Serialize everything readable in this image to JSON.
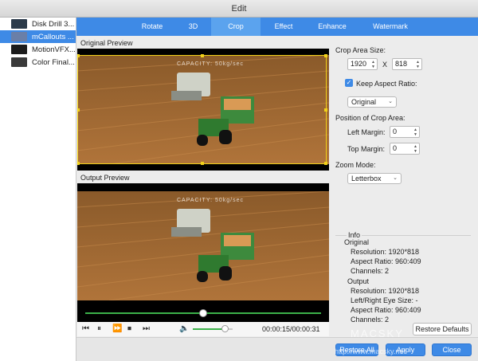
{
  "window": {
    "title": "Edit"
  },
  "files": [
    {
      "name": "Disk Drill 3...",
      "selected": false,
      "thumb_color": "#2b3a4a"
    },
    {
      "name": "mCallouts ...",
      "selected": true,
      "thumb_color": "#6a7fa8"
    },
    {
      "name": "MotionVFX...",
      "selected": false,
      "thumb_color": "#1c1c1c"
    },
    {
      "name": "Color Final...",
      "selected": false,
      "thumb_color": "#3a3a3a"
    }
  ],
  "tabs": [
    {
      "label": "Rotate",
      "active": false
    },
    {
      "label": "3D",
      "active": false
    },
    {
      "label": "Crop",
      "active": true
    },
    {
      "label": "Effect",
      "active": false
    },
    {
      "label": "Enhance",
      "active": false
    },
    {
      "label": "Watermark",
      "active": false
    }
  ],
  "preview": {
    "original_label": "Original Preview",
    "output_label": "Output Preview",
    "overlay_text": "CAPACITY: 50kg/sec"
  },
  "crop": {
    "area_size_label": "Crop Area Size:",
    "width": "1920",
    "x_label": "X",
    "height": "818",
    "keep_aspect_label": "Keep Aspect Ratio:",
    "keep_aspect_checked": true,
    "aspect_value": "Original",
    "position_label": "Position of Crop Area:",
    "left_margin_label": "Left Margin:",
    "left_margin": "0",
    "top_margin_label": "Top Margin:",
    "top_margin": "0",
    "zoom_mode_label": "Zoom Mode:",
    "zoom_mode": "Letterbox"
  },
  "info": {
    "group_label": "Info",
    "original_heading": "Original",
    "original_resolution": "Resolution: 1920*818",
    "original_aspect": "Aspect Ratio: 960:409",
    "original_channels": "Channels: 2",
    "output_heading": "Output",
    "output_resolution": "Resolution: 1920*818",
    "output_eye_size": "Left/Right Eye Size: -",
    "output_aspect": "Aspect Ratio: 960:409",
    "output_channels": "Channels: 2"
  },
  "player": {
    "progress": 0.5,
    "volume": 0.8,
    "time": "00:00:15/00:00:31"
  },
  "buttons": {
    "restore_defaults": "Restore Defaults",
    "restore_all": "Restore All",
    "apply": "Apply",
    "close": "Close"
  },
  "watermark": {
    "line1": "MACSKY",
    "line2": "http://www.macsky.net"
  },
  "colors": {
    "accent": "#3e8ae6",
    "crop_border": "#f1d21a",
    "progress_green": "#3bb14a"
  }
}
